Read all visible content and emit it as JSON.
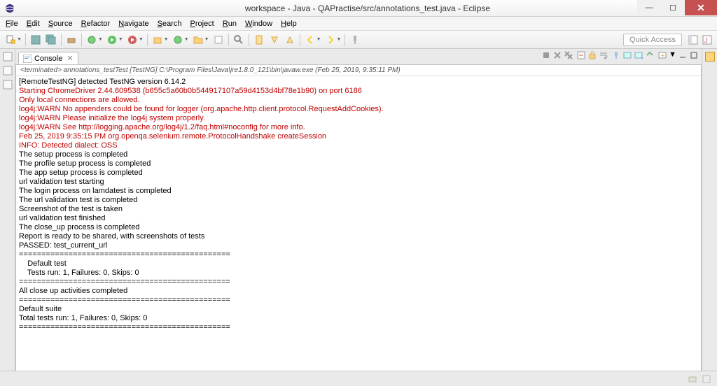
{
  "titlebar": {
    "title": "workspace - Java - QAPractise/src/annotations_test.java - Eclipse"
  },
  "menu": [
    "File",
    "Edit",
    "Source",
    "Refactor",
    "Navigate",
    "Search",
    "Project",
    "Run",
    "Window",
    "Help"
  ],
  "toolbar": {
    "quick_access_placeholder": "Quick Access"
  },
  "console": {
    "tab_label": "Console",
    "subheader": "<terminated> annotations_testTest [TestNG] C:\\Program Files\\Java\\jre1.8.0_121\\bin\\javaw.exe (Feb 25, 2019, 9:35:11 PM)",
    "lines": [
      {
        "text": "[RemoteTestNG] detected TestNG version 6.14.2",
        "cls": ""
      },
      {
        "text": "Starting ChromeDriver 2.44.609538 (b655c5a60b0b544917107a59d4153d4bf78e1b90) on port 6186",
        "cls": "red"
      },
      {
        "text": "Only local connections are allowed.",
        "cls": "red"
      },
      {
        "text": "log4j:WARN No appenders could be found for logger (org.apache.http.client.protocol.RequestAddCookies).",
        "cls": "red"
      },
      {
        "text": "log4j:WARN Please initialize the log4j system properly.",
        "cls": "red"
      },
      {
        "text": "log4j:WARN See http://logging.apache.org/log4j/1.2/faq.html#noconfig for more info.",
        "cls": "red"
      },
      {
        "text": "Feb 25, 2019 9:35:15 PM org.openqa.selenium.remote.ProtocolHandshake createSession",
        "cls": "red"
      },
      {
        "text": "INFO: Detected dialect: OSS",
        "cls": "red"
      },
      {
        "text": "The setup process is completed",
        "cls": ""
      },
      {
        "text": "The profile setup process is completed",
        "cls": ""
      },
      {
        "text": "The app setup process is completed",
        "cls": ""
      },
      {
        "text": "url validation test starting",
        "cls": ""
      },
      {
        "text": "The login process on lamdatest is completed",
        "cls": ""
      },
      {
        "text": "The url validation test is completed",
        "cls": ""
      },
      {
        "text": "Screenshot of the test is taken",
        "cls": ""
      },
      {
        "text": "url validation test finished",
        "cls": ""
      },
      {
        "text": "The close_up process is completed",
        "cls": ""
      },
      {
        "text": "Report is ready to be shared, with screenshots of tests",
        "cls": ""
      },
      {
        "text": "PASSED: test_current_url",
        "cls": ""
      },
      {
        "text": "",
        "cls": ""
      },
      {
        "text": "===============================================",
        "cls": ""
      },
      {
        "text": "    Default test",
        "cls": ""
      },
      {
        "text": "    Tests run: 1, Failures: 0, Skips: 0",
        "cls": ""
      },
      {
        "text": "===============================================",
        "cls": ""
      },
      {
        "text": "",
        "cls": ""
      },
      {
        "text": "All close up activities completed",
        "cls": ""
      },
      {
        "text": "",
        "cls": ""
      },
      {
        "text": "===============================================",
        "cls": ""
      },
      {
        "text": "Default suite",
        "cls": ""
      },
      {
        "text": "Total tests run: 1, Failures: 0, Skips: 0",
        "cls": ""
      },
      {
        "text": "===============================================",
        "cls": ""
      }
    ]
  }
}
